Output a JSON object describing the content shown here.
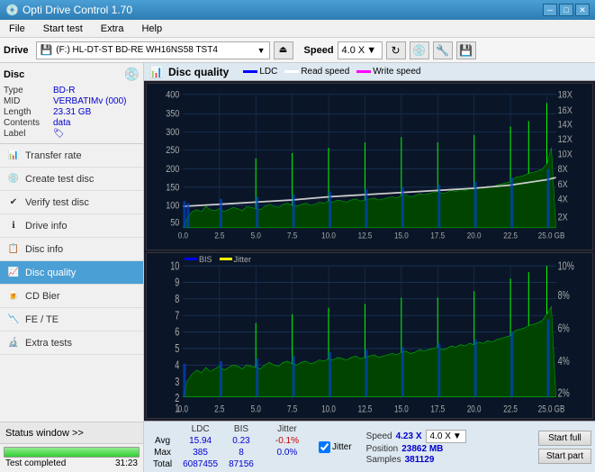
{
  "app": {
    "title": "Opti Drive Control 1.70",
    "icon": "💿"
  },
  "titlebar": {
    "minimize": "─",
    "maximize": "□",
    "close": "✕"
  },
  "menu": {
    "items": [
      "File",
      "Start test",
      "Extra",
      "Help"
    ]
  },
  "toolbar": {
    "drive_label": "Drive",
    "drive_value": "(F:)  HL-DT-ST BD-RE  WH16NS58 TST4",
    "speed_label": "Speed",
    "speed_value": "4.0 X"
  },
  "disc": {
    "header": "Disc",
    "type_label": "Type",
    "type_value": "BD-R",
    "mid_label": "MID",
    "mid_value": "VERBATIMv (000)",
    "length_label": "Length",
    "length_value": "23.31 GB",
    "contents_label": "Contents",
    "contents_value": "data",
    "label_label": "Label"
  },
  "nav": {
    "items": [
      {
        "id": "transfer-rate",
        "label": "Transfer rate",
        "active": false
      },
      {
        "id": "create-test-disc",
        "label": "Create test disc",
        "active": false
      },
      {
        "id": "verify-test-disc",
        "label": "Verify test disc",
        "active": false
      },
      {
        "id": "drive-info",
        "label": "Drive info",
        "active": false
      },
      {
        "id": "disc-info",
        "label": "Disc info",
        "active": false
      },
      {
        "id": "disc-quality",
        "label": "Disc quality",
        "active": true
      },
      {
        "id": "cd-bier",
        "label": "CD Bier",
        "active": false
      },
      {
        "id": "fe-te",
        "label": "FE / TE",
        "active": false
      },
      {
        "id": "extra-tests",
        "label": "Extra tests",
        "active": false
      }
    ]
  },
  "status": {
    "window_label": "Status window >>",
    "progress_value": 100,
    "status_text": "Test completed",
    "time": "31:23"
  },
  "chart": {
    "title": "Disc quality",
    "legend": {
      "ldc_label": "LDC",
      "ldc_color": "#0000ff",
      "read_speed_label": "Read speed",
      "read_speed_color": "#ffffff",
      "write_speed_label": "Write speed",
      "write_speed_color": "#ff00ff"
    },
    "legend2": {
      "bis_label": "BIS",
      "bis_color": "#00aa00",
      "jitter_label": "Jitter",
      "jitter_color": "#ffff00"
    },
    "top": {
      "y_max": 400,
      "y_labels": [
        "400",
        "350",
        "300",
        "250",
        "200",
        "150",
        "100",
        "50"
      ],
      "y_right": [
        "18X",
        "16X",
        "14X",
        "12X",
        "10X",
        "8X",
        "6X",
        "4X",
        "2X"
      ],
      "x_labels": [
        "0.0",
        "2.5",
        "5.0",
        "7.5",
        "10.0",
        "12.5",
        "15.0",
        "17.5",
        "20.0",
        "22.5",
        "25.0 GB"
      ]
    },
    "bottom": {
      "y_max": 10,
      "y_labels": [
        "10",
        "9",
        "8",
        "7",
        "6",
        "5",
        "4",
        "3",
        "2",
        "1"
      ],
      "y_right": [
        "10%",
        "8%",
        "6%",
        "4%",
        "2%"
      ],
      "x_labels": [
        "0.0",
        "2.5",
        "5.0",
        "7.5",
        "10.0",
        "12.5",
        "15.0",
        "17.5",
        "20.0",
        "22.5",
        "25.0 GB"
      ]
    }
  },
  "stats": {
    "ldc_label": "LDC",
    "bis_label": "BIS",
    "jitter_label": "Jitter",
    "jitter_checked": true,
    "avg_label": "Avg",
    "max_label": "Max",
    "total_label": "Total",
    "ldc_avg": "15.94",
    "ldc_max": "385",
    "ldc_total": "6087455",
    "bis_avg": "0.23",
    "bis_max": "8",
    "bis_total": "87156",
    "jitter_avg": "-0.1%",
    "jitter_max": "0.0%",
    "speed_label": "Speed",
    "speed_value": "4.23 X",
    "speed_select": "4.0 X",
    "position_label": "Position",
    "position_value": "23862 MB",
    "samples_label": "Samples",
    "samples_value": "381129",
    "start_full_label": "Start full",
    "start_part_label": "Start part"
  }
}
